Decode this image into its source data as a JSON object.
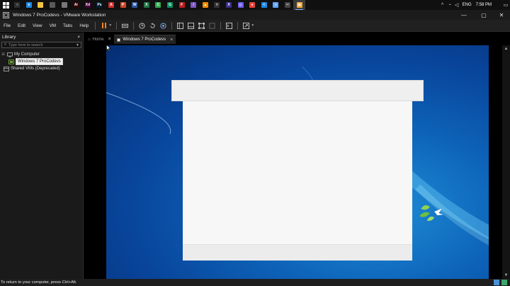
{
  "taskbar": {
    "apps": [
      {
        "name": "cortana",
        "color": "#2f2f2f",
        "glyph": "○"
      },
      {
        "name": "edge",
        "color": "#1e88e5",
        "glyph": "e"
      },
      {
        "name": "file-explorer",
        "color": "#f4c542",
        "glyph": ""
      },
      {
        "name": "store",
        "color": "#5a5a5a",
        "glyph": ""
      },
      {
        "name": "mail",
        "color": "#777777",
        "glyph": ""
      },
      {
        "name": "illustrator",
        "color": "#330000",
        "glyph": "Ai"
      },
      {
        "name": "xd",
        "color": "#470137",
        "glyph": "Xd"
      },
      {
        "name": "photoshop",
        "color": "#001e36",
        "glyph": "Ps"
      },
      {
        "name": "acrobat",
        "color": "#d32f2f",
        "glyph": "A"
      },
      {
        "name": "powerpoint",
        "color": "#d24726",
        "glyph": "P"
      },
      {
        "name": "word",
        "color": "#2b579a",
        "glyph": "W"
      },
      {
        "name": "excel",
        "color": "#217346",
        "glyph": "X"
      },
      {
        "name": "camtasia",
        "color": "#2fa84f",
        "glyph": "C"
      },
      {
        "name": "gitkraken",
        "color": "#0a8f5a",
        "glyph": "G"
      },
      {
        "name": "filezilla",
        "color": "#bf1d1d",
        "glyph": "F"
      },
      {
        "name": "feather",
        "color": "#7e57c2",
        "glyph": "/"
      },
      {
        "name": "vlc",
        "color": "#ef8c00",
        "glyph": "▲"
      },
      {
        "name": "cmd",
        "color": "#333333",
        "glyph": ">"
      },
      {
        "name": "xampp",
        "color": "#3b2f8c",
        "glyph": "X"
      },
      {
        "name": "discord",
        "color": "#6c5ce7",
        "glyph": "◎"
      },
      {
        "name": "chrome",
        "color": "#e94235",
        "glyph": "●"
      },
      {
        "name": "vscode",
        "color": "#1e88e5",
        "glyph": "<"
      },
      {
        "name": "notepad",
        "color": "#60a5fa",
        "glyph": "≡"
      },
      {
        "name": "capcut",
        "color": "#444444",
        "glyph": "✂"
      },
      {
        "name": "vmware",
        "color": "#f4a836",
        "glyph": "▣"
      }
    ],
    "language": "ENG",
    "time": "7:58 PM"
  },
  "window": {
    "title": "Windows 7 ProCodevs - VMware Workstation"
  },
  "menu": {
    "items": [
      "File",
      "Edit",
      "View",
      "VM",
      "Tabs",
      "Help"
    ]
  },
  "library": {
    "title": "Library",
    "close": "×",
    "search_placeholder": "Type here to search",
    "tree": {
      "root": "My Computer",
      "vm": "Windows 7 ProCodevs",
      "shared": "Shared VMs (Deprecated)"
    }
  },
  "tabs": [
    {
      "label": "Home",
      "icon": "⌂"
    },
    {
      "label": "Windows 7 ProCodevs",
      "icon": "▣"
    }
  ],
  "status": {
    "text": "To return to your computer, press Ctrl+Alt."
  },
  "colors": {
    "accent": "#f4821f",
    "desktop_blue": "#0d63b8",
    "taskbar": "#101010"
  }
}
